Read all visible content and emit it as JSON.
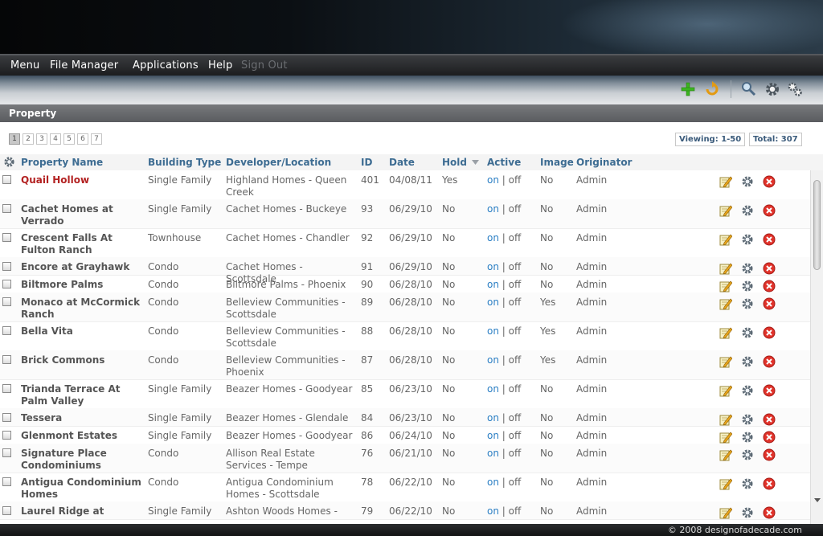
{
  "menu": {
    "items": [
      "Menu",
      "File Manager",
      "Applications",
      "Help"
    ],
    "sign_out": "Sign Out"
  },
  "toolbar": {
    "icons": [
      "add-icon",
      "refresh-icon",
      "search-icon",
      "settings-gear-icon",
      "gears-icon"
    ]
  },
  "section": {
    "title": "Property"
  },
  "pagination": {
    "pages": [
      "1",
      "2",
      "3",
      "4",
      "5",
      "6",
      "7"
    ],
    "current": "1",
    "viewing": "Viewing: 1-50",
    "total": "Total: 307"
  },
  "table": {
    "headers": {
      "name": "Property Name",
      "building_type": "Building Type",
      "developer": "Developer/Location",
      "id": "ID",
      "date": "Date",
      "hold": "Hold",
      "active": "Active",
      "image": "Image",
      "originator": "Originator"
    },
    "on_label": "on",
    "separator": "|",
    "off_label": "off",
    "rows": [
      {
        "name": "Quail Hollow",
        "type": "Single Family",
        "developer": "Highland Homes - Queen Creek",
        "id": "401",
        "date": "04/08/11",
        "hold": "Yes",
        "image": "No",
        "originator": "Admin"
      },
      {
        "name": "Cachet Homes at Verrado",
        "type": "Single Family",
        "developer": "Cachet Homes - Buckeye",
        "id": "93",
        "date": "06/29/10",
        "hold": "No",
        "image": "No",
        "originator": "Admin"
      },
      {
        "name": "Crescent Falls At Fulton Ranch",
        "type": "Townhouse",
        "developer": "Cachet Homes - Chandler",
        "id": "92",
        "date": "06/29/10",
        "hold": "No",
        "image": "No",
        "originator": "Admin"
      },
      {
        "name": "Encore at Grayhawk",
        "type": "Condo",
        "developer": "Cachet Homes - Scottsdale",
        "id": "91",
        "date": "06/29/10",
        "hold": "No",
        "image": "No",
        "originator": "Admin"
      },
      {
        "name": "Biltmore Palms",
        "type": "Condo",
        "developer": "Biltmore Palms - Phoenix",
        "id": "90",
        "date": "06/28/10",
        "hold": "No",
        "image": "No",
        "originator": "Admin"
      },
      {
        "name": "Monaco at McCormick Ranch",
        "type": "Condo",
        "developer": "Belleview Communities - Scottsdale",
        "id": "89",
        "date": "06/28/10",
        "hold": "No",
        "image": "Yes",
        "originator": "Admin"
      },
      {
        "name": "Bella Vita",
        "type": "Condo",
        "developer": "Belleview Communities - Scottsdale",
        "id": "88",
        "date": "06/28/10",
        "hold": "No",
        "image": "Yes",
        "originator": "Admin"
      },
      {
        "name": "Brick Commons",
        "type": "Condo",
        "developer": "Belleview Communities - Phoenix",
        "id": "87",
        "date": "06/28/10",
        "hold": "No",
        "image": "Yes",
        "originator": "Admin"
      },
      {
        "name": "Trianda Terrace At Palm Valley",
        "type": "Single Family",
        "developer": "Beazer Homes - Goodyear",
        "id": "85",
        "date": "06/23/10",
        "hold": "No",
        "image": "No",
        "originator": "Admin"
      },
      {
        "name": "Tessera",
        "type": "Single Family",
        "developer": "Beazer Homes - Glendale",
        "id": "84",
        "date": "06/23/10",
        "hold": "No",
        "image": "No",
        "originator": "Admin"
      },
      {
        "name": "Glenmont Estates",
        "type": "Single Family",
        "developer": "Beazer Homes - Goodyear",
        "id": "86",
        "date": "06/24/10",
        "hold": "No",
        "image": "No",
        "originator": "Admin"
      },
      {
        "name": "Signature Place Condominiums",
        "type": "Condo",
        "developer": "Allison Real Estate Services - Tempe",
        "id": "76",
        "date": "06/21/10",
        "hold": "No",
        "image": "No",
        "originator": "Admin"
      },
      {
        "name": "Antigua Condominium Homes",
        "type": "Condo",
        "developer": "Antigua Condominium Homes - Scottsdale",
        "id": "78",
        "date": "06/22/10",
        "hold": "No",
        "image": "No",
        "originator": "Admin"
      },
      {
        "name": "Laurel Ridge at",
        "type": "Single Family",
        "developer": "Ashton Woods Homes -",
        "id": "79",
        "date": "06/22/10",
        "hold": "No",
        "image": "No",
        "originator": "Admin"
      }
    ]
  },
  "footer": {
    "copyright": "© 2008 designofadecade.com"
  },
  "colors": {
    "header_blue": "#3d6c92",
    "highlight_red": "#b32222",
    "link_blue": "#2b7fc4"
  }
}
